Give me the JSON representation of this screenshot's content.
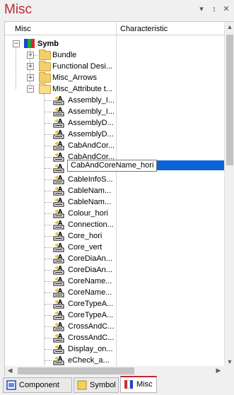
{
  "window": {
    "title": "Misc",
    "pin_glyph": "▾",
    "autohide_glyph": "↕",
    "close_glyph": "✕"
  },
  "grid": {
    "columns": [
      "Misc",
      "Characteristic"
    ],
    "root": {
      "label": "Symb"
    },
    "folders": [
      "Bundle",
      "Functional Desi...",
      "Misc_Arrows",
      "Misc_Attribute t..."
    ],
    "items": [
      "Assembly_I...",
      "Assembly_I...",
      "AssemblyD...",
      "AssemblyD...",
      "CabAndCor...",
      "CabAndCor...",
      "CableInfo",
      "CableInfoS...",
      "CableNam...",
      "CableNam...",
      "Colour_hori",
      "Connection...",
      "Core_hori",
      "Core_vert",
      "CoreDiaAn...",
      "CoreDiaAn...",
      "CoreName...",
      "CoreName...",
      "CoreTypeA...",
      "CoreTypeA...",
      "CrossAndC...",
      "CrossAndC...",
      "Display_on...",
      "eCheck_a..."
    ],
    "tooltip": "CabAndCoreName_hori"
  },
  "tabs": [
    {
      "label": "Component",
      "active": false
    },
    {
      "label": "Symbol",
      "active": false
    },
    {
      "label": "Misc",
      "active": true
    }
  ],
  "colors": {
    "accent": "#c0282f",
    "selection": "#0a64d8",
    "folder": "#f3cf6b"
  }
}
